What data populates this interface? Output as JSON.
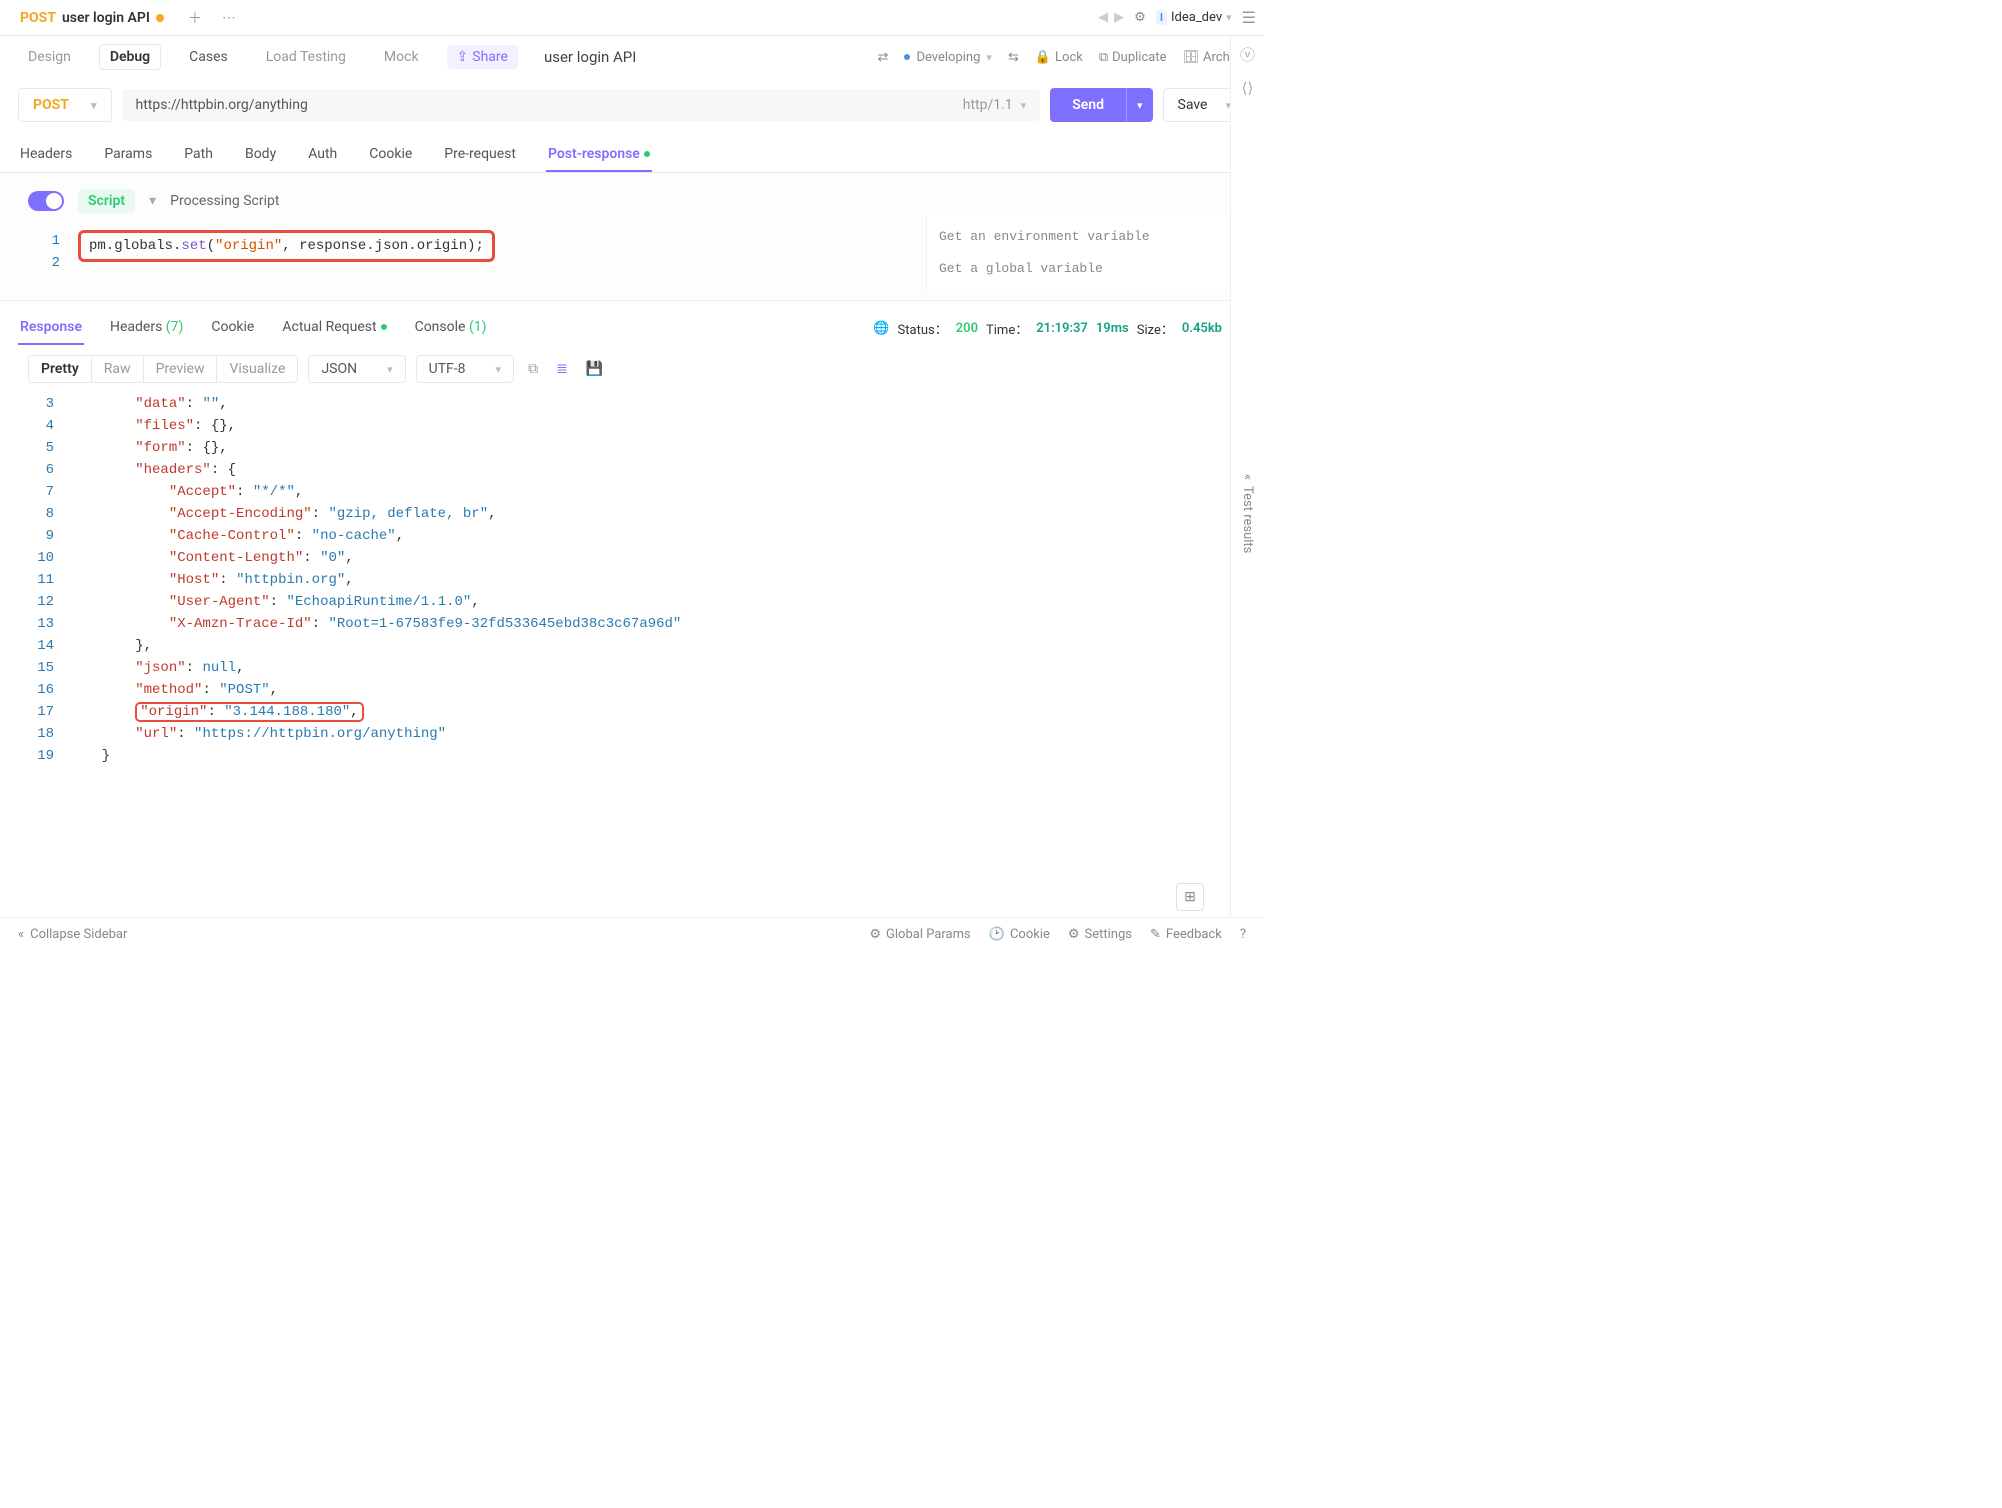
{
  "top": {
    "tab_method": "POST",
    "tab_title": "user login API",
    "env_letter": "I",
    "env_name": "Idea_dev"
  },
  "subnav": {
    "design": "Design",
    "debug": "Debug",
    "cases": "Cases",
    "load": "Load Testing",
    "mock": "Mock",
    "share": "Share",
    "api_name": "user login API",
    "status": "Developing",
    "lock": "Lock",
    "duplicate": "Duplicate",
    "archive": "Archive"
  },
  "request": {
    "method": "POST",
    "url": "https://httpbin.org/anything",
    "http_ver": "http/1.1",
    "send": "Send",
    "save": "Save"
  },
  "req_tabs": {
    "headers": "Headers",
    "params": "Params",
    "path": "Path",
    "body": "Body",
    "auth": "Auth",
    "cookie": "Cookie",
    "prereq": "Pre-request",
    "postresp": "Post-response"
  },
  "script": {
    "badge": "Script",
    "label": "Processing Script",
    "line1_a": "pm.globals.",
    "line1_b": "set",
    "line1_c": "(",
    "line1_d": "\"origin\"",
    "line1_e": ", response.json.origin);",
    "hint1": "Get an environment variable",
    "hint2": "Get a global variable"
  },
  "resp_tabs": {
    "response": "Response",
    "headers": "Headers",
    "headers_count": "(7)",
    "cookie": "Cookie",
    "actual": "Actual Request",
    "console": "Console",
    "console_count": "(1)"
  },
  "resp_meta": {
    "status_label": "Status：",
    "status_code": "200",
    "time_label": "Time：",
    "time_val": "21:19:37",
    "elapsed": "19ms",
    "size_label": "Size：",
    "size_val": "0.45kb"
  },
  "resp_toolbar": {
    "pretty": "Pretty",
    "raw": "Raw",
    "preview": "Preview",
    "visualize": "Visualize",
    "format": "JSON",
    "encoding": "UTF-8"
  },
  "json": {
    "lines": [
      {
        "n": 3,
        "indent": 2,
        "key": "\"data\"",
        "sep": ": ",
        "val": "\"\"",
        "trail": ","
      },
      {
        "n": 4,
        "indent": 2,
        "key": "\"files\"",
        "sep": ": ",
        "brace": "{}",
        "trail": ","
      },
      {
        "n": 5,
        "indent": 2,
        "key": "\"form\"",
        "sep": ": ",
        "brace": "{}",
        "trail": ","
      },
      {
        "n": 6,
        "indent": 2,
        "key": "\"headers\"",
        "sep": ": ",
        "brace": "{",
        "trail": ""
      },
      {
        "n": 7,
        "indent": 3,
        "key": "\"Accept\"",
        "sep": ": ",
        "val": "\"*/*\"",
        "trail": ","
      },
      {
        "n": 8,
        "indent": 3,
        "key": "\"Accept-Encoding\"",
        "sep": ": ",
        "val": "\"gzip, deflate, br\"",
        "trail": ","
      },
      {
        "n": 9,
        "indent": 3,
        "key": "\"Cache-Control\"",
        "sep": ": ",
        "val": "\"no-cache\"",
        "trail": ","
      },
      {
        "n": 10,
        "indent": 3,
        "key": "\"Content-Length\"",
        "sep": ": ",
        "val": "\"0\"",
        "trail": ","
      },
      {
        "n": 11,
        "indent": 3,
        "key": "\"Host\"",
        "sep": ": ",
        "val": "\"httpbin.org\"",
        "trail": ","
      },
      {
        "n": 12,
        "indent": 3,
        "key": "\"User-Agent\"",
        "sep": ": ",
        "val": "\"EchoapiRuntime/1.1.0\"",
        "trail": ","
      },
      {
        "n": 13,
        "indent": 3,
        "key": "\"X-Amzn-Trace-Id\"",
        "sep": ": ",
        "val": "\"Root=1-67583fe9-32fd533645ebd38c3c67a96d\"",
        "trail": ""
      },
      {
        "n": 14,
        "indent": 2,
        "brace": "},",
        "trail": ""
      },
      {
        "n": 15,
        "indent": 2,
        "key": "\"json\"",
        "sep": ": ",
        "null": "null",
        "trail": ","
      },
      {
        "n": 16,
        "indent": 2,
        "key": "\"method\"",
        "sep": ": ",
        "val": "\"POST\"",
        "trail": ","
      },
      {
        "n": 17,
        "indent": 2,
        "highlight": true,
        "key": "\"origin\"",
        "sep": ": ",
        "val": "\"3.144.188.180\"",
        "trail": ","
      },
      {
        "n": 18,
        "indent": 2,
        "key": "\"url\"",
        "sep": ": ",
        "val": "\"https://httpbin.org/anything\"",
        "trail": ""
      },
      {
        "n": 19,
        "indent": 1,
        "brace": "}",
        "trail": ""
      }
    ]
  },
  "side": {
    "test_results": "Test results"
  },
  "bottom": {
    "collapse": "Collapse Sidebar",
    "global": "Global Params",
    "cookie": "Cookie",
    "settings": "Settings",
    "feedback": "Feedback"
  }
}
